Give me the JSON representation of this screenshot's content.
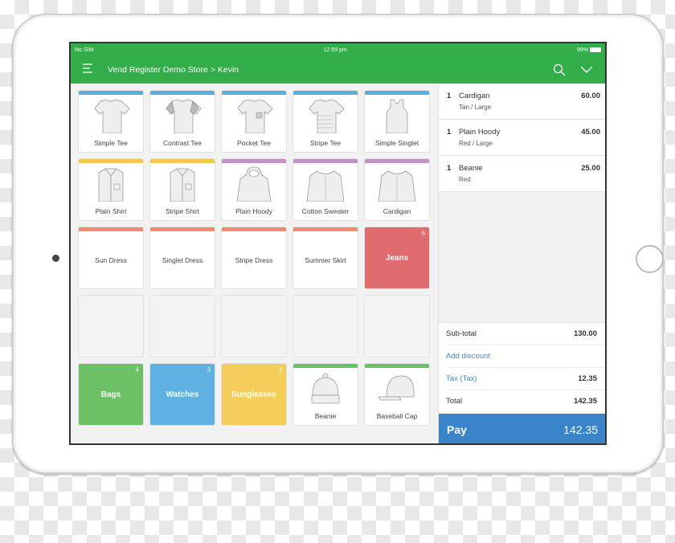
{
  "status": {
    "carrier": "No SIM",
    "time": "12:59 pm",
    "battery": "99%"
  },
  "header": {
    "title": "Vend Register Demo Store > Kevin"
  },
  "colors": {
    "green": "#33ad4a",
    "blue": "#3a85c9"
  },
  "tiles": [
    {
      "label": "Simple Tee",
      "bar": "#5aafe0",
      "icon": "tee"
    },
    {
      "label": "Contrast Tee",
      "bar": "#5aafe0",
      "icon": "tee-contrast"
    },
    {
      "label": "Pocket Tee",
      "bar": "#5aafe0",
      "icon": "tee-pocket"
    },
    {
      "label": "Stripe Tee",
      "bar": "#5aafe0",
      "icon": "tee-stripe"
    },
    {
      "label": "Simple Singlet",
      "bar": "#5aafe0",
      "icon": "singlet"
    },
    {
      "label": "Plain Shirt",
      "bar": "#f5c84c",
      "icon": "shirt"
    },
    {
      "label": "Stripe Shirt",
      "bar": "#f5c84c",
      "icon": "shirt"
    },
    {
      "label": "Plain Hoody",
      "bar": "#c391c8",
      "icon": "hoodie"
    },
    {
      "label": "Cotton Sweater",
      "bar": "#c391c8",
      "icon": "sweater"
    },
    {
      "label": "Cardigan",
      "bar": "#c391c8",
      "icon": "sweater"
    },
    {
      "label": "Sun Dress",
      "bar": "#f4896b"
    },
    {
      "label": "Singlet Dress",
      "bar": "#f4896b"
    },
    {
      "label": "Stripe Dress",
      "bar": "#f4896b"
    },
    {
      "label": "Summer Skirt",
      "bar": "#f4896b"
    },
    {
      "label": "Jeans",
      "category": true,
      "color": "#e06b6f",
      "count": "6"
    },
    {
      "empty": true
    },
    {
      "empty": true
    },
    {
      "empty": true
    },
    {
      "empty": true
    },
    {
      "empty": true
    },
    {
      "label": "Bags",
      "category": true,
      "color": "#6cc065",
      "count": "4"
    },
    {
      "label": "Watches",
      "category": true,
      "color": "#5eb1e0",
      "count": "3"
    },
    {
      "label": "Sunglasses",
      "category": true,
      "color": "#f5cd5a",
      "count": "3"
    },
    {
      "label": "Beanie",
      "bar": "#6cc065",
      "icon": "beanie"
    },
    {
      "label": "Baseball Cap",
      "bar": "#6cc065",
      "icon": "cap"
    }
  ],
  "cart": {
    "items": [
      {
        "qty": "1",
        "name": "Cardigan",
        "variant": "Tan / Large",
        "price": "60.00"
      },
      {
        "qty": "1",
        "name": "Plain Hoody",
        "variant": "Red / Large",
        "price": "45.00"
      },
      {
        "qty": "1",
        "name": "Beanie",
        "variant": "Red",
        "price": "25.00"
      }
    ],
    "subtotal_label": "Sub-total",
    "subtotal": "130.00",
    "discount_label": "Add discount",
    "tax_label": "Tax (Tax)",
    "tax": "12.35",
    "total_label": "Total",
    "total": "142.35",
    "pay_label": "Pay",
    "pay_amount": "142.35"
  }
}
